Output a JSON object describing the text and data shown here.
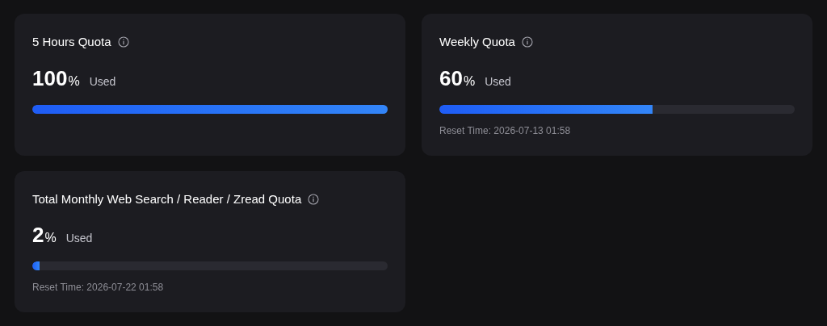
{
  "quotas": [
    {
      "title": "5 Hours Quota",
      "value": "100",
      "unit": "%",
      "label": "Used",
      "level": 1.0
    },
    {
      "title": "Weekly Quota",
      "value": "60",
      "unit": "%",
      "label": "Used",
      "level": 0.6,
      "reset": "Reset Time: 2026-07-13 01:58"
    },
    {
      "title": "Total Monthly Web Search / Reader / Zread Quota",
      "value": "2",
      "unit": "%",
      "label": "Used",
      "level": 0.02,
      "reset": "Reset Time: 2026-07-22 01:58"
    }
  ]
}
